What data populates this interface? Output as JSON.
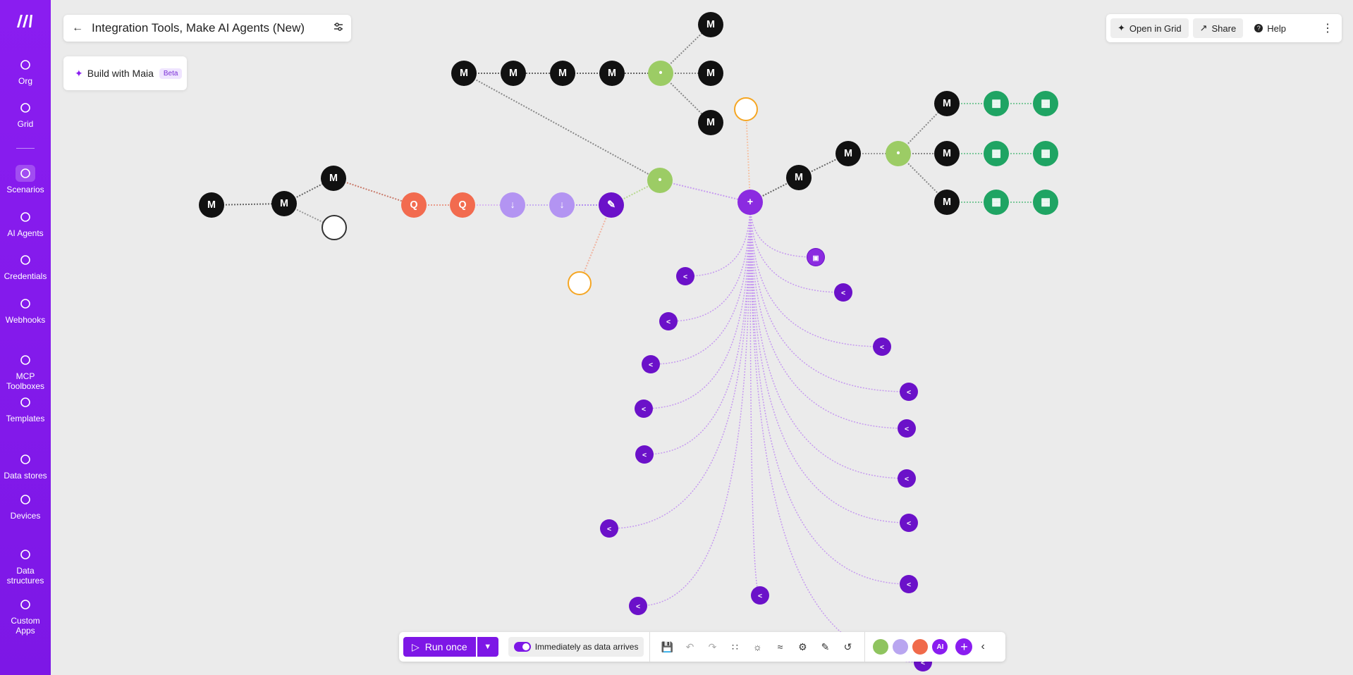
{
  "sidebar": {
    "items": [
      {
        "label": "Org",
        "icon": "home-icon"
      },
      {
        "label": "Grid",
        "icon": "grid-icon"
      },
      {
        "label": "Scenarios",
        "icon": "scenarios-icon",
        "active": true
      },
      {
        "label": "AI Agents",
        "icon": "ai-agents-icon"
      },
      {
        "label": "Credentials",
        "icon": "credentials-icon"
      },
      {
        "label": "Webhooks",
        "icon": "webhooks-icon"
      },
      {
        "label": "MCP Toolboxes",
        "icon": "mcp-icon"
      },
      {
        "label": "Templates",
        "icon": "templates-icon"
      },
      {
        "label": "Data stores",
        "icon": "data-stores-icon"
      },
      {
        "label": "Devices",
        "icon": "devices-icon"
      },
      {
        "label": "Data structures",
        "icon": "data-structures-icon"
      },
      {
        "label": "Custom Apps",
        "icon": "custom-apps-icon"
      }
    ]
  },
  "header": {
    "title": "Integration Tools, Make AI Agents (New)"
  },
  "maia": {
    "label": "Build with Maia",
    "badge": "Beta"
  },
  "toolbar_top": {
    "open_in_grid": "Open in Grid",
    "share": "Share",
    "help": "Help"
  },
  "bottom_bar": {
    "run_once": "Run once",
    "schedule": "Immediately as data arrives",
    "badge_colors": [
      "#8fc45f",
      "#b9a6f0",
      "#f06a4a",
      "#8a1df0"
    ],
    "ai_label": "AI"
  },
  "colors": {
    "accent": "#7d17e6",
    "make_black": "#111111",
    "router_green": "#9ccc65",
    "sheets_green": "#1fa463",
    "agent_purple": "#6b11c9",
    "tool_orange": "#f26b4f",
    "datastore_lavender": "#b394f2",
    "sleep_orange": "#f5a623"
  }
}
